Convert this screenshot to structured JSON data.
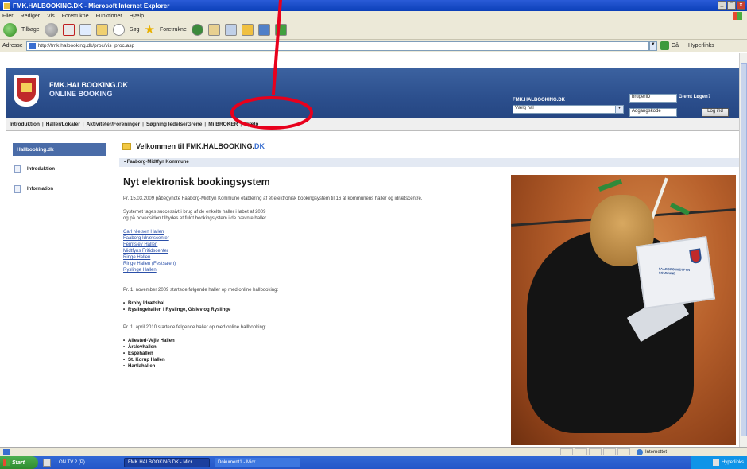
{
  "window": {
    "title": "FMK.HALBOOKING.DK - Microsoft Internet Explorer",
    "min": "_",
    "max": "□",
    "close": "x"
  },
  "menu": [
    "Filer",
    "Rediger",
    "Vis",
    "Foretrukne",
    "Funktioner",
    "Hjælp"
  ],
  "toolbar": {
    "back_label": "Tilbage",
    "search_label": "Søg",
    "favorites_label": "Foretrukne"
  },
  "address": {
    "label": "Adresse",
    "url": "http://fmk.halbooking.dk/proc/vis_proc.asp",
    "dropdown": "▼",
    "go_label": "Gå",
    "links_label": "Hyperlinks"
  },
  "site": {
    "brand_line1": "FMK.HALBOOKING.DK",
    "brand_line2": "ONLINE BOOKING",
    "select_label": "FMK.HALBOOKING.DK",
    "select_value": "Vælg hal",
    "select_arrow": "▼",
    "login_user": "brugerID",
    "login_pass": "Adgangskode",
    "forgot_link": "Glemt Løgen?",
    "login_button": "Log ind"
  },
  "nav": [
    "Introduktion",
    "Haller/Lokaler",
    "Aktiviteter/Foreninger",
    "Søgning ledelse/Grene",
    "Mi BROKER",
    "Hjælp"
  ],
  "nav_separator": "|",
  "leftnav": {
    "active": "Hallbooking.dk",
    "items": [
      "Introduktion",
      "Information"
    ]
  },
  "welcome": {
    "prefix": "Velkommen til FMK.HALBOOKING.",
    "suffix": "DK"
  },
  "breadcrumb": "• Faaborg-Midtfyn Kommune",
  "content": {
    "heading": "Nyt elektronisk bookingsystem",
    "p1": "Pr. 15.03.2009 påbegyndte Faaborg-Midtfyn Kommune etablering af et elektronisk bookingsystem til 16 af kommunens haller og idrætscentre.",
    "p2a": "Systemet tages successivt i brug af de enkelte haller i løbet af 2009",
    "p2b": "og på hovedsiden tilbydes et fuldt bookingsystem i de nævnte haller.",
    "links": [
      "Carl Nielsen Hallen",
      "Faaborg Idrætscenter",
      "Ferritslev Hallen",
      "Midtfyns Fritidscenter",
      "Ringe Hallen",
      "Ringe Hallen (Festsalen)",
      "Ryslinge Hallen"
    ],
    "p3": "Pr. 1. november 2009 startede følgende haller op med online hallbooking:",
    "list1": [
      "Broby Idrætshal",
      "Ryslingehallen i Ryslinge, Gislev og Ryslinge"
    ],
    "p4": "Pr. 1. april 2010 startede følgende haller op med online hallbooking:",
    "list2": [
      "Allested-Vejle Hallen",
      "Årslevhallen",
      "Espehallen",
      "St. Korup Hallen",
      "Hartlahallen"
    ]
  },
  "photo_laptop_text": "FAABORG-MIDTFYN KOMMUNE",
  "statusbar": {
    "zone": "Internettet"
  },
  "taskbar": {
    "start": "Start",
    "task1": "ON TV 2 (P)",
    "task2": "FMK.HALBOOKING.DK - Micr...",
    "task3": "Dokument1 - Micr...",
    "tray_label": "Hyperlinks"
  },
  "colors": {
    "header_blue": "#2c4f8d",
    "annotation_red": "#e8001c",
    "link_blue": "#2a4fa8"
  }
}
